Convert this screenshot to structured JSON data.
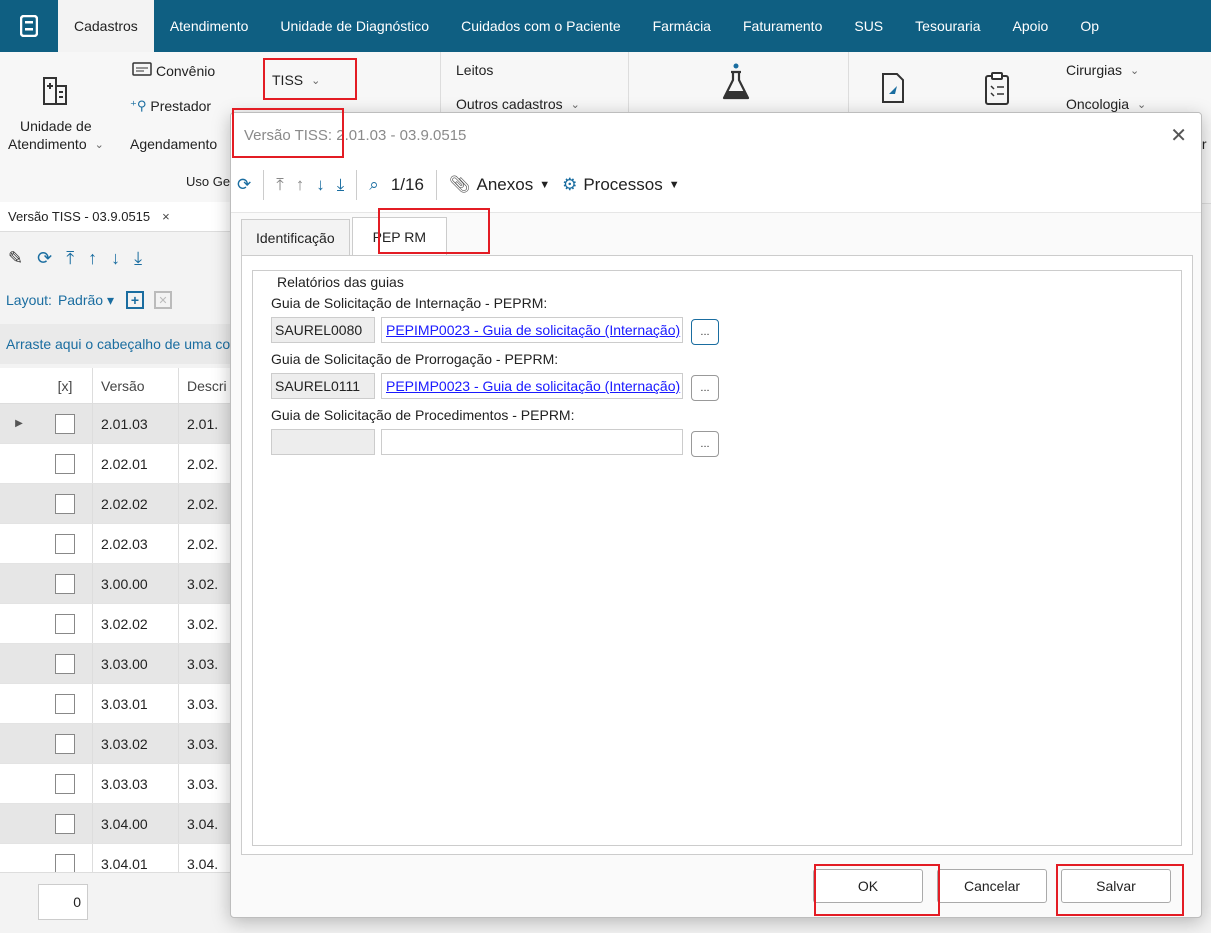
{
  "menubar": {
    "items": [
      "Cadastros",
      "Atendimento",
      "Unidade de Diagnóstico",
      "Cuidados com o Paciente",
      "Farmácia",
      "Faturamento",
      "SUS",
      "Tesouraria",
      "Apoio",
      "Op"
    ]
  },
  "ribbon": {
    "unidade_line1": "Unidade de",
    "unidade_line2": "Atendimento",
    "convenio": "Convênio",
    "prestador": "Prestador",
    "agendamento": "Agendamento",
    "uso_geral": "Uso Ge",
    "tiss": "TISS",
    "leitos": "Leitos",
    "outros_cadastros": "Outros cadastros",
    "cirurgias": "Cirurgias",
    "oncologia": "Oncologia",
    "cut_tr": "tr"
  },
  "doc": {
    "tab_title": "Versão TISS - 03.9.0515",
    "layout_label": "Layout:",
    "layout_value": "Padrão",
    "drag_hint": "Arraste aqui o cabeçalho de uma coluna"
  },
  "grid": {
    "columns": [
      "[x]",
      "Versão",
      "Descri"
    ],
    "rows": [
      {
        "versao": "2.01.03",
        "desc": "2.01."
      },
      {
        "versao": "2.02.01",
        "desc": "2.02."
      },
      {
        "versao": "2.02.02",
        "desc": "2.02."
      },
      {
        "versao": "2.02.03",
        "desc": "2.02."
      },
      {
        "versao": "3.00.00",
        "desc": "3.02."
      },
      {
        "versao": "3.02.02",
        "desc": "3.02."
      },
      {
        "versao": "3.03.00",
        "desc": "3.03."
      },
      {
        "versao": "3.03.01",
        "desc": "3.03."
      },
      {
        "versao": "3.03.02",
        "desc": "3.03."
      },
      {
        "versao": "3.03.03",
        "desc": "3.03."
      },
      {
        "versao": "3.04.00",
        "desc": "3.04."
      },
      {
        "versao": "3.04.01",
        "desc": "3.04."
      }
    ],
    "counter": "0"
  },
  "dialog": {
    "title": "Versão TISS: 2.01.03 - 03.9.0515",
    "record_nav": "1/16",
    "anexos": "Anexos",
    "processos": "Processos",
    "tabs": [
      "Identificação",
      "PEP RM"
    ],
    "group_title": "Relatórios das guias",
    "fields": [
      {
        "label": "Guia de Solicitação de Internação - PEPRM:",
        "code": "SAUREL0080",
        "desc": "PEPIMP0023 - Guia de solicitação (Internação)"
      },
      {
        "label": "Guia de Solicitação de Prorrogação - PEPRM:",
        "code": "SAUREL0111",
        "desc": "PEPIMP0023 - Guia de solicitação (Internação)"
      },
      {
        "label": "Guia de Solicitação de Procedimentos - PEPRM:",
        "code": "",
        "desc": ""
      }
    ],
    "ellipsis": "...",
    "buttons": {
      "ok": "OK",
      "cancel": "Cancelar",
      "save": "Salvar"
    }
  }
}
